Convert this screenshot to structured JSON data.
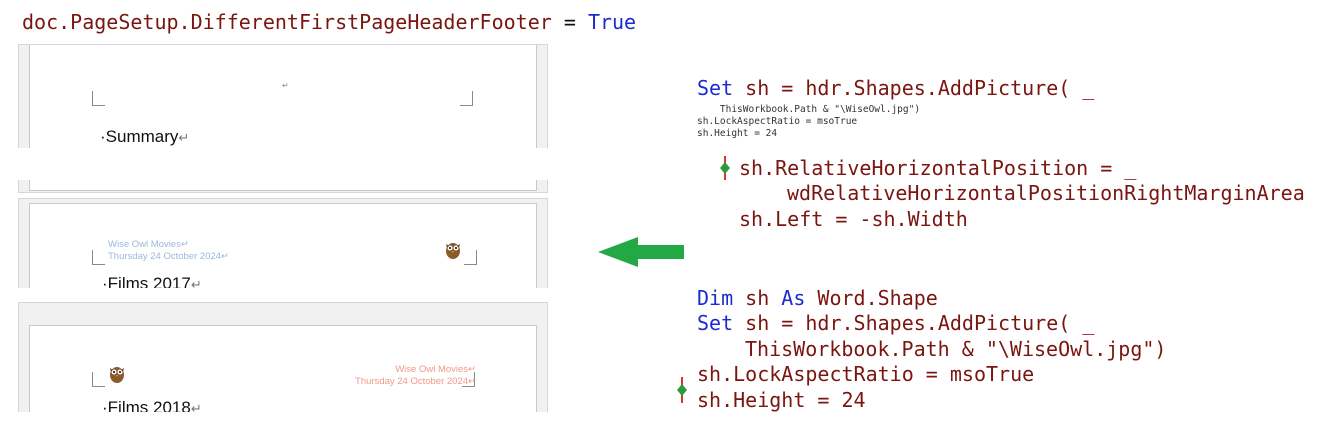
{
  "top_code": {
    "object": "doc.PageSetup.DifferentFirstPageHeaderFooter",
    "op": " = ",
    "value": "True"
  },
  "pages": [
    {
      "heading": "·Summary",
      "mark": "↵",
      "header_mark": "↵"
    },
    {
      "heading": "·Films 2017",
      "mark": "↵",
      "header_lines": [
        "Wise Owl Movies↵",
        "Thursday 24 October 2024↵"
      ]
    },
    {
      "heading": "·Films 2018",
      "mark": "↵",
      "header_lines": [
        "Wise Owl Movies↵",
        "Thursday 24 October 2024↵"
      ]
    }
  ],
  "snippet1": {
    "set_kw": "Set",
    "line1_rest": " sh = hdr.Shapes.AddPicture( _",
    "small_lines": [
      "    ThisWorkbook.Path & \"\\WiseOwl.jpg\")",
      "sh.LockAspectRatio = msoTrue",
      "sh.Height = 24"
    ],
    "line_a": "sh.RelativeHorizontalPosition = _",
    "line_b": "wdRelativeHorizontalPositionRightMarginArea",
    "line_c": "sh.Left = -sh.Width"
  },
  "snippet2": {
    "dim_kw": "Dim",
    "dim_mid": " sh ",
    "as_kw": "As",
    "dim_type": " Word.Shape",
    "set_kw": "Set",
    "set_rest": " sh = hdr.Shapes.AddPicture( _",
    "path_line": "ThisWorkbook.Path & \"\\WiseOwl.jpg\")",
    "lock_line": "sh.LockAspectRatio = msoTrue",
    "height_line": "sh.Height = 24"
  },
  "colors": {
    "keyword": "#1c2bd0",
    "identifier": "#7a1510",
    "arrow": "#22a845",
    "marker_red": "#d9372b",
    "marker_green": "#2c9a3c"
  }
}
